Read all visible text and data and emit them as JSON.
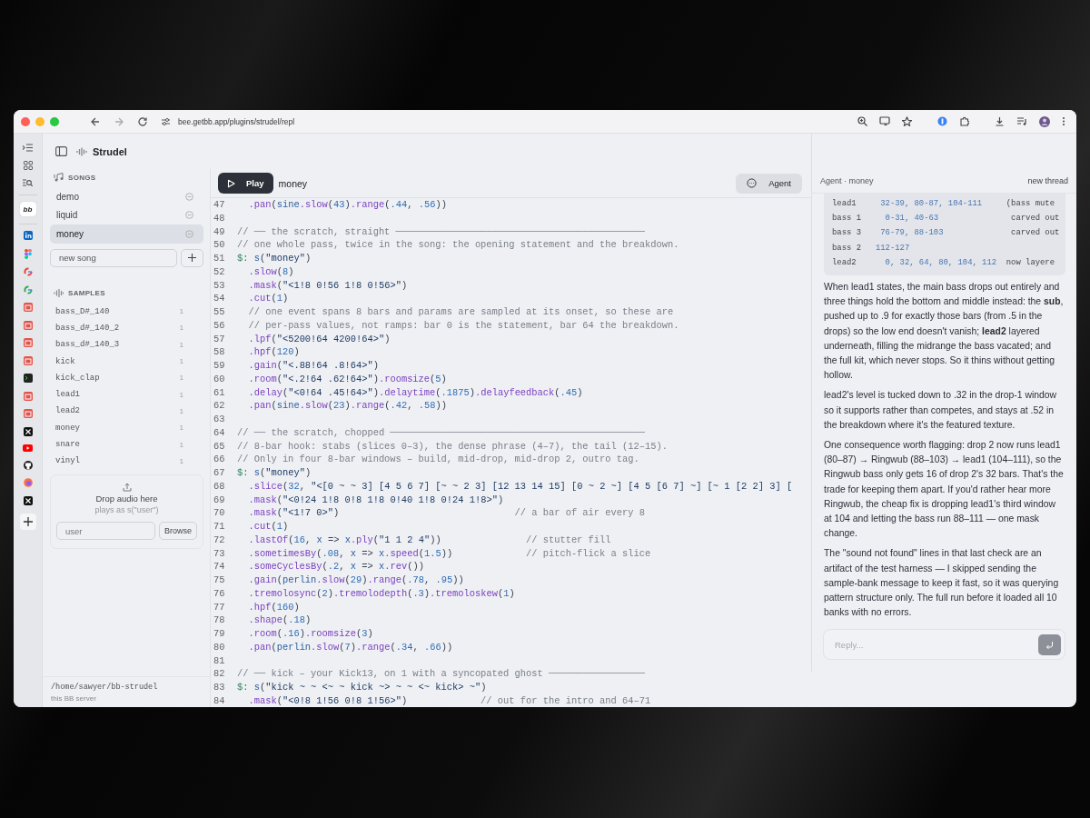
{
  "browser": {
    "url": "bee.getbb.app/plugins/strudel/repl"
  },
  "strip": {
    "logo": "bb"
  },
  "app": {
    "title": "Strudel"
  },
  "sidebar": {
    "songs_heading": "SONGS",
    "songs": [
      {
        "name": "demo",
        "selected": false
      },
      {
        "name": "liquid",
        "selected": false
      },
      {
        "name": "money",
        "selected": true
      }
    ],
    "new_song": {
      "placeholder": "new song"
    },
    "samples_heading": "SAMPLES",
    "samples": [
      {
        "name": "bass_D#_140",
        "count": "1"
      },
      {
        "name": "bass_d#_140_2",
        "count": "1"
      },
      {
        "name": "bass_d#_140_3",
        "count": "1"
      },
      {
        "name": "kick",
        "count": "1"
      },
      {
        "name": "kick_clap",
        "count": "1"
      },
      {
        "name": "lead1",
        "count": "1"
      },
      {
        "name": "lead2",
        "count": "1"
      },
      {
        "name": "money",
        "count": "1"
      },
      {
        "name": "snare",
        "count": "1"
      },
      {
        "name": "vinyl",
        "count": "1"
      }
    ],
    "drop_zone": {
      "title": "Drop audio here",
      "hint": "plays as s(\"user\")",
      "field": {
        "placeholder": "user"
      },
      "button": "Browse"
    },
    "footer": {
      "path": "/home/sawyer/bb-strudel",
      "caption": "this BB server"
    }
  },
  "toolbar": {
    "play_button": "Play",
    "song_title": "money",
    "agent_button": "Agent"
  },
  "editor": {
    "lines": [
      {
        "number": "47",
        "text": "  .pan(sine.slow(43).range(.44, .56))"
      },
      {
        "number": "48"
      },
      {
        "number": "49",
        "text": "// ── the scratch, straight ────────────────────────────────────────────"
      },
      {
        "number": "50",
        "text": "// one whole pass, twice in the song: the opening statement and the breakdown."
      },
      {
        "number": "51",
        "text": "$: s(\"money\")"
      },
      {
        "number": "52",
        "text": "  .slow(8)"
      },
      {
        "number": "53",
        "text": "  .mask(\"<1!8 0!56 1!8 0!56>\")"
      },
      {
        "number": "54",
        "text": "  .cut(1)"
      },
      {
        "number": "55",
        "text": "  // one event spans 8 bars and params are sampled at its onset, so these are"
      },
      {
        "number": "56",
        "text": "  // per-pass values, not ramps: bar 0 is the statement, bar 64 the breakdown."
      },
      {
        "number": "57",
        "text": "  .lpf(\"<5200!64 4200!64>\")"
      },
      {
        "number": "58",
        "text": "  .hpf(120)"
      },
      {
        "number": "59",
        "text": "  .gain(\"<.88!64 .8!64>\")"
      },
      {
        "number": "60",
        "text": "  .room(\"<.2!64 .62!64>\").roomsize(5)"
      },
      {
        "number": "61",
        "text": "  .delay(\"<0!64 .45!64>\").delaytime(.1875).delayfeedback(.45)"
      },
      {
        "number": "62",
        "text": "  .pan(sine.slow(23).range(.42, .58))"
      },
      {
        "number": "63"
      },
      {
        "number": "64",
        "text": "// ── the scratch, chopped ─────────────────────────────────────────────"
      },
      {
        "number": "65",
        "text": "// 8-bar hook: stabs (slices 0–3), the dense phrase (4–7), the tail (12–15)."
      },
      {
        "number": "66",
        "text": "// Only in four 8-bar windows – build, mid-drop, mid-drop 2, outro tag."
      },
      {
        "number": "67",
        "text": "$: s(\"money\")"
      },
      {
        "number": "68",
        "text": "  .slice(32, \"<[0 ~ ~ 3] [4 5 6 7] [~ ~ 2 3] [12 13 14 15] [0 ~ 2 ~] [4 5 [6 7] ~] [~ 1 [2 2] 3] ["
      },
      {
        "number": "69",
        "text": "  .mask(\"<0!24 1!8 0!8 1!8 0!40 1!8 0!24 1!8>\")"
      },
      {
        "number": "70",
        "text": "  .mask(\"<1!7 0>\")",
        "comment": "// a bar of air every 8"
      },
      {
        "number": "71",
        "text": "  .cut(1)"
      },
      {
        "number": "72",
        "text": "  .lastOf(16, x => x.ply(\"1 1 2 4\"))",
        "comment": "// stutter fill"
      },
      {
        "number": "73",
        "text": "  .sometimesBy(.08, x => x.speed(1.5))",
        "comment": "// pitch-flick a slice"
      },
      {
        "number": "74",
        "text": "  .someCyclesBy(.2, x => x.rev())"
      },
      {
        "number": "75",
        "text": "  .gain(perlin.slow(29).range(.78, .95))"
      },
      {
        "number": "76",
        "text": "  .tremolosync(2).tremolodepth(.3).tremoloskew(1)"
      },
      {
        "number": "77",
        "text": "  .hpf(160)"
      },
      {
        "number": "78",
        "text": "  .shape(.18)"
      },
      {
        "number": "79",
        "text": "  .room(.16).roomsize(3)"
      },
      {
        "number": "80",
        "text": "  .pan(perlin.slow(7).range(.34, .66))"
      },
      {
        "number": "81"
      },
      {
        "number": "82",
        "text": "// ── kick – your Kick13, on 1 with a syncopated ghost ─────────────────"
      },
      {
        "number": "83",
        "text": "$: s(\"kick ~ ~ <~ ~ kick ~> ~ ~ <~ kick> ~\")"
      },
      {
        "number": "84",
        "text": "  .mask(\"<0!8 1!56 0!8 1!56>\")",
        "comment": "// out for the intro and 64–71"
      }
    ]
  },
  "agent": {
    "title": "Agent · money",
    "new_thread": "new thread",
    "table_lines": [
      "lead1     32-39, 80-87, 104-111     (bass mute",
      "bass 1     0-31, 40-63               carved out",
      "bass 3    76-79, 88-103              carved out",
      "bass 2   112-127",
      "lead2      0, 32, 64, 80, 104, 112  now layere"
    ],
    "paragraphs": [
      "When lead1 states, the main bass drops out entirely and three things hold the bottom and middle instead: the **sub**, pushed up to .9 for exactly those bars (from .5 in the drops) so the low end doesn't vanish; **lead2** layered underneath, filling the midrange the bass vacated; and the full kit, which never stops. So it thins without getting hollow.",
      "lead2's level is tucked down to .32 in the drop-1 window so it supports rather than competes, and stays at .52 in the breakdown where it's the featured texture.",
      "One consequence worth flagging: drop 2 now runs lead1 (80–87) → Ringwub (88–103) → lead1 (104–111), so the Ringwub bass only gets 16 of drop 2's 32 bars. That's the trade for keeping them apart. If you'd rather hear more Ringwub, the cheap fix is dropping lead1's third window at 104 and letting the bass run 88–111 — one mask change.",
      "The \"sound not found\" lines in that last check are an artifact of the test harness — I skipped sending the sample-bank message to keep it fast, so it was querying pattern structure only. The full run before it loaded all 10 banks with no errors."
    ],
    "reply": {
      "placeholder": "Reply..."
    }
  }
}
